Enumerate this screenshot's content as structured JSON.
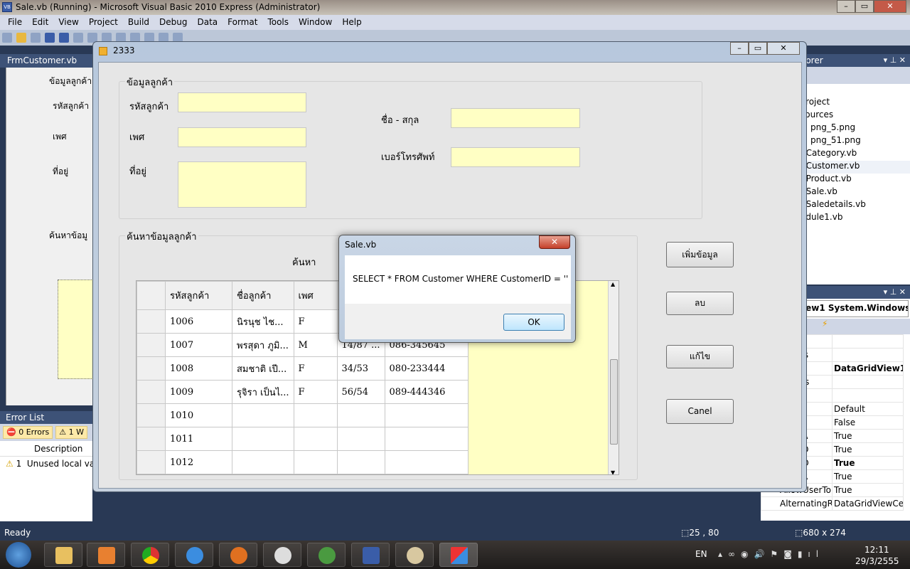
{
  "ide": {
    "title": "Sale.vb (Running) - Microsoft Visual Basic 2010 Express (Administrator)",
    "menu": [
      "File",
      "Edit",
      "View",
      "Project",
      "Build",
      "Debug",
      "Data",
      "Format",
      "Tools",
      "Window",
      "Help"
    ],
    "doc_tab": "FrmCustomer.vb",
    "designer_labels": [
      "ข้อมูลลูกค้า",
      "รหัสลูกค้า",
      "เพศ",
      "ที่อยู่",
      "ค้นหาข้อมู"
    ],
    "error_list": {
      "title": "Error List",
      "errors": "0 Errors",
      "warnings": "1 W",
      "col_description": "Description",
      "row_num": "1",
      "row_desc": "Unused local va"
    },
    "solution_explorer": {
      "title": "lorer",
      "items": [
        "b",
        "Project",
        "sources",
        "png_5.png",
        "png_51.png",
        "nCategory.vb",
        "nCustomer.vb",
        "nProduct.vb",
        "nSale.vb",
        "nSaledetails.vb",
        "odule1.vb"
      ]
    },
    "properties": {
      "object": "iew1 System.Windows.",
      "rows": [
        [
          "ationS",
          ""
        ],
        [
          "ndings",
          ""
        ],
        [
          "",
          "DataGridView1"
        ],
        [
          "bleDes",
          ""
        ],
        [
          "bleNa",
          ""
        ],
        [
          "bleRol",
          "Default"
        ],
        [
          "rop",
          "False"
        ],
        [
          "serToA",
          "True"
        ],
        [
          "serToD",
          "True"
        ],
        [
          "serToO",
          "True"
        ],
        [
          "serToR",
          "True"
        ],
        [
          "AllowUserToR",
          "True"
        ],
        [
          "AlternatingRc",
          "DataGridViewCe"
        ]
      ]
    },
    "status": {
      "text": "Ready",
      "position": "25 , 80",
      "size": "680 x 274"
    }
  },
  "form": {
    "title": "2333",
    "group1": "ข้อมูลลูกค้า",
    "labels": {
      "id": "รหัสลูกค้า",
      "gender": "เพศ",
      "address": "ที่อยู่",
      "name": "ชื่อ - สกุล",
      "phone": "เบอร์โทรศัพท์"
    },
    "group2": "ค้นหาข้อมูลลูกค้า",
    "search_label": "ค้นหา",
    "grid": {
      "columns": [
        "รหัสลูกค้า",
        "ชื่อลูกค้า",
        "เพศ",
        "",
        ""
      ],
      "rows": [
        [
          "1006",
          "นิรนุช ไช...",
          "F",
          "",
          ""
        ],
        [
          "1007",
          "พรสุดา ภูมิ...",
          "M",
          "14/87 ...",
          "086-345645"
        ],
        [
          "1008",
          "สมชาติ เปี...",
          "F",
          "34/53",
          "080-233444"
        ],
        [
          "1009",
          "รุจิรา เป็นไ...",
          "F",
          "56/54",
          "089-444346"
        ],
        [
          "1010",
          "",
          "",
          "",
          ""
        ],
        [
          "1011",
          "",
          "",
          "",
          ""
        ],
        [
          "1012",
          "",
          "",
          "",
          ""
        ]
      ]
    },
    "buttons": {
      "add": "เพิ่มข้อมูล",
      "delete": "ลบ",
      "edit": "แก้ไข",
      "cancel": "Canel"
    }
  },
  "dialog": {
    "title": "Sale.vb",
    "message": "SELECT * FROM Customer WHERE CustomerID = ''",
    "ok": "OK"
  },
  "taskbar": {
    "lang": "EN",
    "time": "12:11",
    "date": "29/3/2555"
  }
}
